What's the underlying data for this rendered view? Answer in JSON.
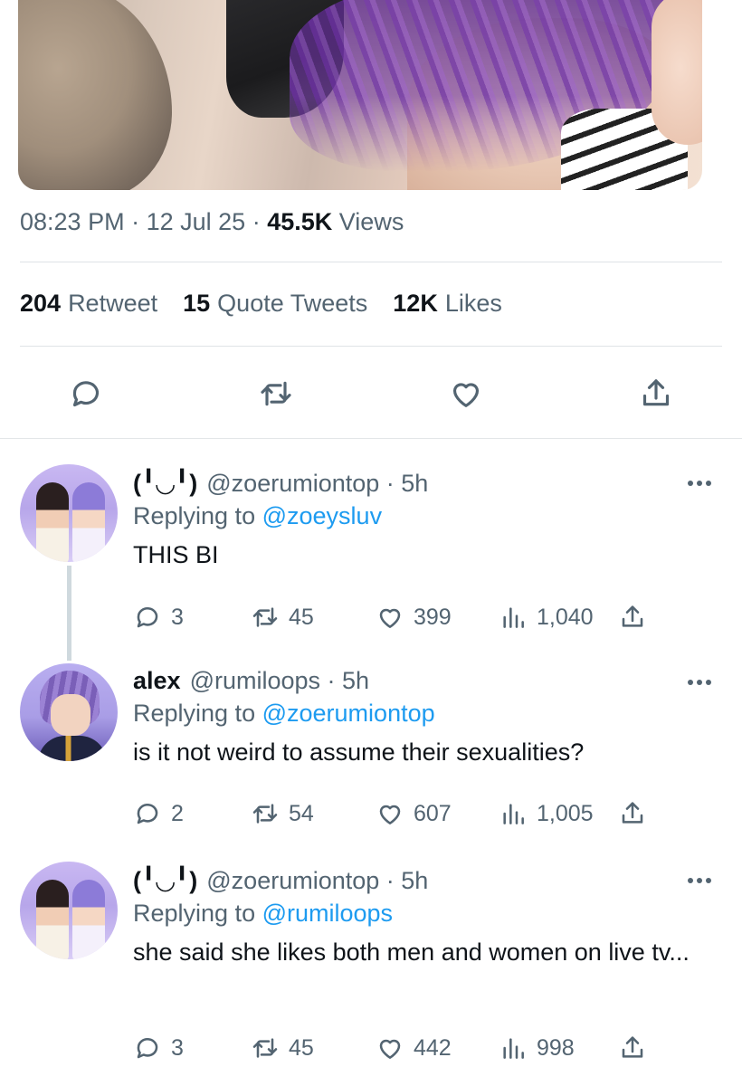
{
  "tweet": {
    "time": "08:23 PM",
    "date": "12 Jul 25",
    "views_count": "45.5K",
    "views_label": "Views",
    "stats": {
      "retweets_count": "204",
      "retweets_label": "Retweet",
      "quotes_count": "15",
      "quotes_label": "Quote Tweets",
      "likes_count": "12K",
      "likes_label": "Likes"
    },
    "actions": [
      "reply-icon",
      "retweet-icon",
      "like-icon",
      "share-icon"
    ]
  },
  "replies": [
    {
      "display_name": "(╹◡╹)",
      "handle": "@zoerumiontop",
      "age": "· 5h",
      "replying_prefix": "Replying to",
      "replying_to": "@zoeysluv",
      "text": "THIS BI",
      "replies": "3",
      "retweets": "45",
      "likes": "399",
      "views": "1,040"
    },
    {
      "display_name": "alex",
      "handle": "@rumiloops",
      "age": "· 5h",
      "replying_prefix": "Replying to",
      "replying_to": "@zoerumiontop",
      "text": "is it not weird to assume their sexualities?",
      "replies": "2",
      "retweets": "54",
      "likes": "607",
      "views": "1,005"
    },
    {
      "display_name": "(╹◡╹)",
      "handle": "@zoerumiontop",
      "age": "· 5h",
      "replying_prefix": "Replying to",
      "replying_to": "@rumiloops",
      "text": "she said she likes both men and women on live tv...",
      "replies": "3",
      "retweets": "45",
      "likes": "442",
      "views": "998"
    }
  ],
  "colors": {
    "text": "#0f1419",
    "secondary": "#536471",
    "link": "#1d9bf0",
    "divider": "#dfe3e6"
  }
}
